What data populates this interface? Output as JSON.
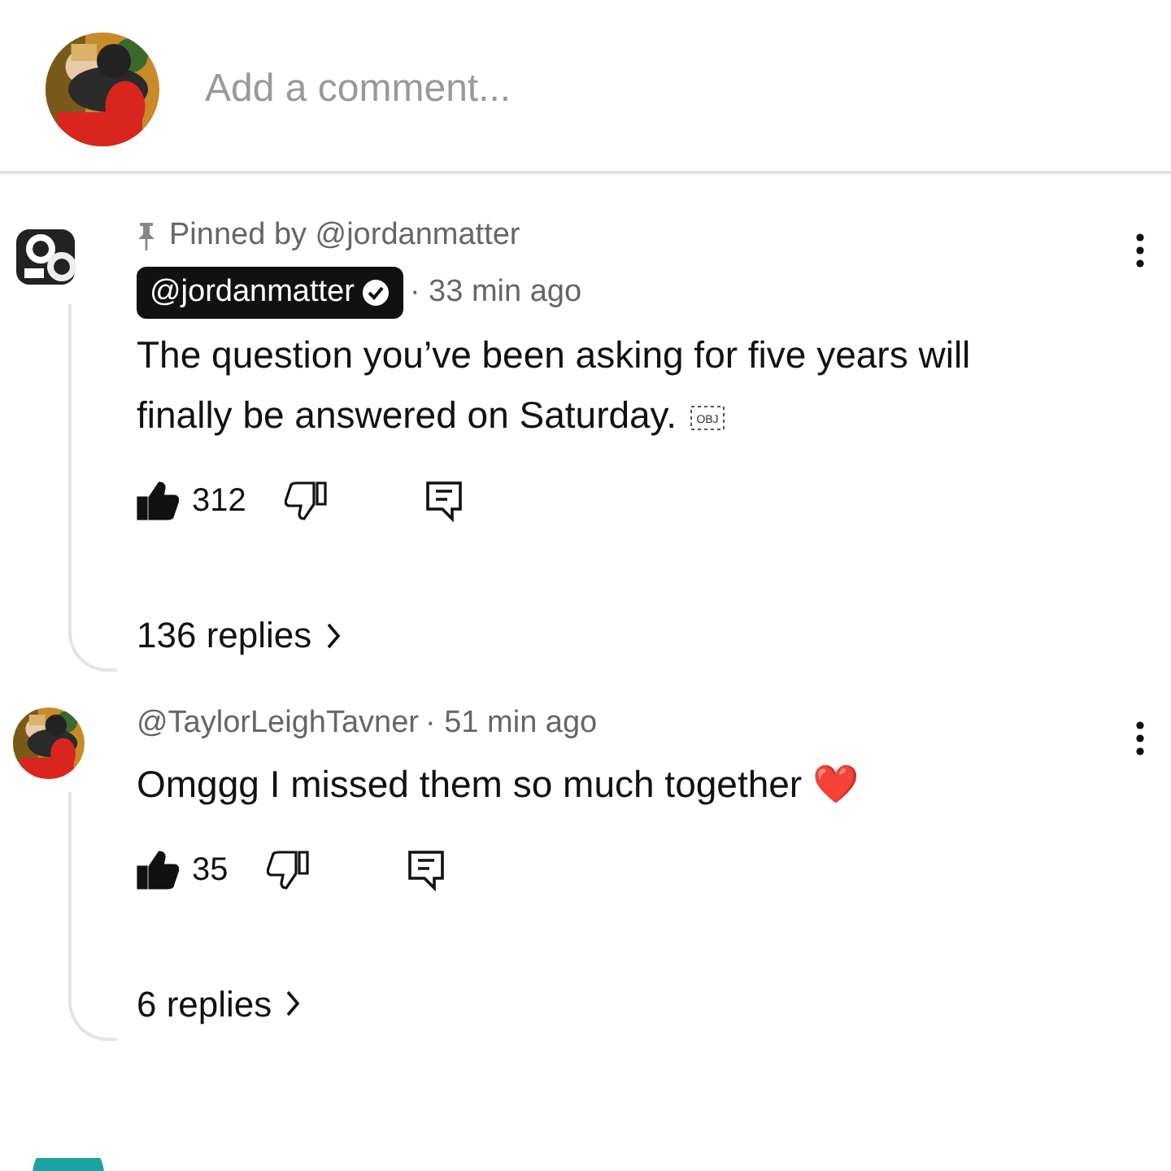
{
  "composer": {
    "placeholder": "Add a comment..."
  },
  "comments": [
    {
      "pinned_label": "Pinned by @jordanmatter",
      "author": "@jordanmatter",
      "creator": true,
      "verified": true,
      "time": "· 33 min ago",
      "text": "The question you’ve been asking for five years will finally be answered on Saturday.",
      "object_marker": "OBJ",
      "likes": "312",
      "liked": true,
      "replies": "136 replies",
      "kind": "pinned"
    },
    {
      "author": "@TaylorLeighTavner",
      "creator": false,
      "verified": false,
      "time": "· 51 min ago",
      "text": "Omggg I missed them so much together ❤️",
      "likes": "35",
      "liked": true,
      "replies": "6 replies",
      "kind": "plain"
    }
  ]
}
